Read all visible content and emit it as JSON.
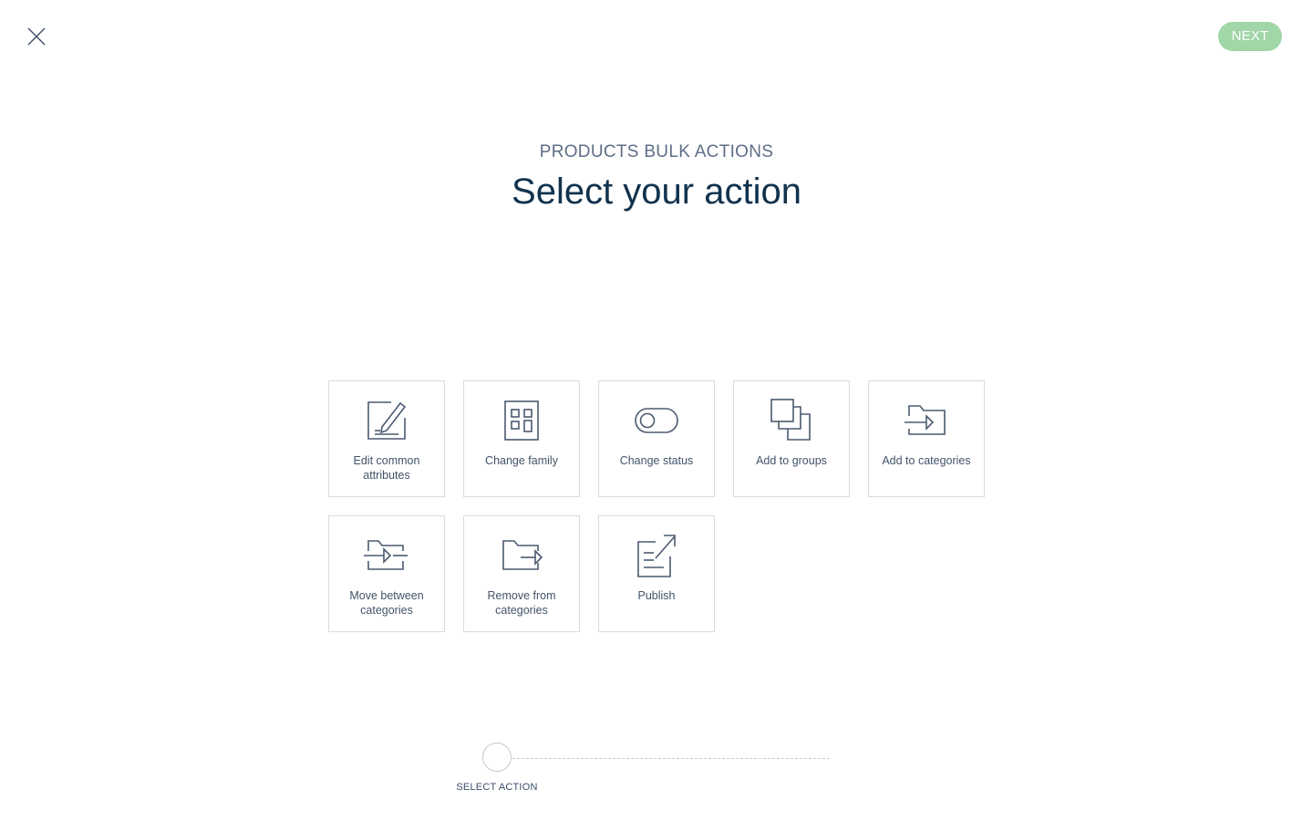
{
  "header": {
    "subtitle": "PRODUCTS BULK ACTIONS",
    "title": "Select your action"
  },
  "toolbar": {
    "close_icon": "close-icon",
    "next_label": "NEXT",
    "next_color": "#a1d6a8"
  },
  "actions": [
    {
      "label": "Edit common attributes",
      "icon": "edit-attributes-icon"
    },
    {
      "label": "Change family",
      "icon": "family-icon"
    },
    {
      "label": "Change status",
      "icon": "toggle-status-icon"
    },
    {
      "label": "Add to groups",
      "icon": "groups-icon"
    },
    {
      "label": "Add to categories",
      "icon": "folder-add-icon"
    },
    {
      "label": "Move between categories",
      "icon": "folder-move-icon"
    },
    {
      "label": "Remove from categories",
      "icon": "folder-remove-icon"
    },
    {
      "label": "Publish",
      "icon": "publish-icon"
    }
  ],
  "stepper": {
    "steps": [
      {
        "label": "SELECT ACTION",
        "state": "current"
      }
    ]
  },
  "colors": {
    "text_dark": "#11324d",
    "text_muted": "#5e6e86",
    "tile_border": "#d7dbe0",
    "icon_stroke": "#4b5a70"
  }
}
